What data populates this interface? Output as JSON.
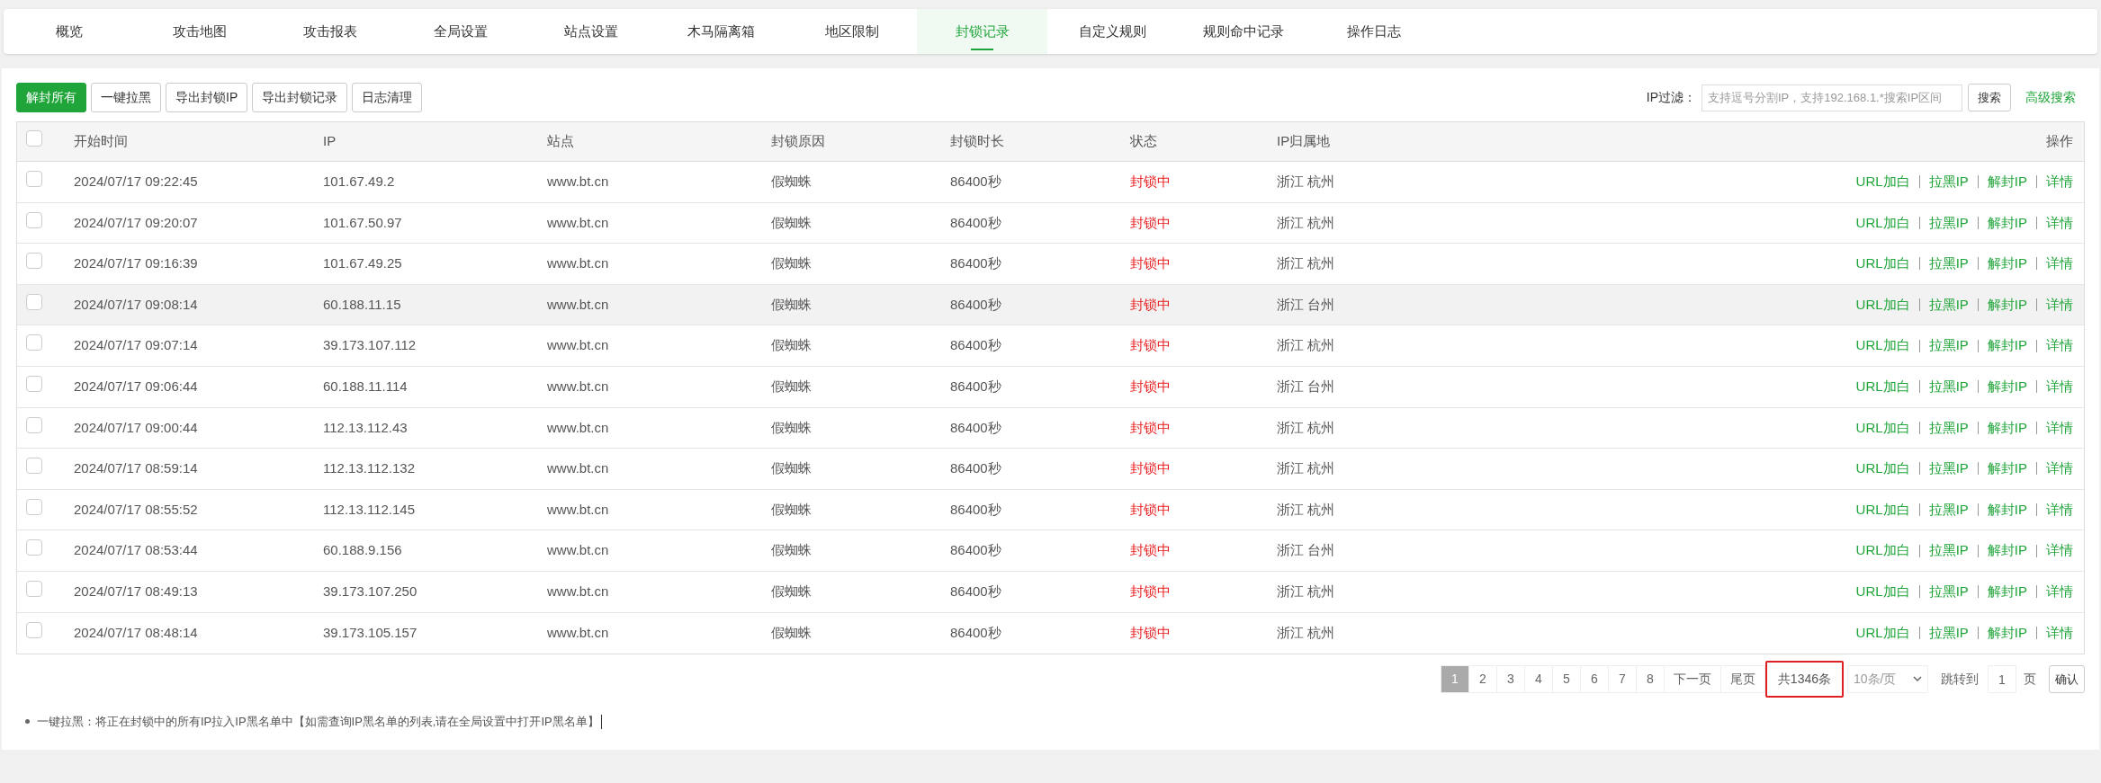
{
  "tabs": [
    {
      "label": "概览",
      "selected": false
    },
    {
      "label": "攻击地图",
      "selected": false
    },
    {
      "label": "攻击报表",
      "selected": false
    },
    {
      "label": "全局设置",
      "selected": false
    },
    {
      "label": "站点设置",
      "selected": false
    },
    {
      "label": "木马隔离箱",
      "selected": false
    },
    {
      "label": "地区限制",
      "selected": false
    },
    {
      "label": "封锁记录",
      "selected": true
    },
    {
      "label": "自定义规则",
      "selected": false
    },
    {
      "label": "规则命中记录",
      "selected": false
    },
    {
      "label": "操作日志",
      "selected": false
    }
  ],
  "toolbar": {
    "buttons": [
      {
        "label": "解封所有",
        "kind": "primary"
      },
      {
        "label": "一键拉黑",
        "kind": "default"
      },
      {
        "label": "导出封锁IP",
        "kind": "default"
      },
      {
        "label": "导出封锁记录",
        "kind": "default"
      },
      {
        "label": "日志清理",
        "kind": "default"
      }
    ],
    "filter": {
      "label": "IP过滤：",
      "placeholder": "支持逗号分割IP，支持192.168.1.*搜索IP区间",
      "button": "搜索",
      "link": "高级搜索"
    }
  },
  "table": {
    "select_all_checked": false,
    "columns": [
      "开始时间",
      "IP",
      "站点",
      "封锁原因",
      "封锁时长",
      "状态",
      "IP归属地",
      "操作"
    ],
    "rows": [
      {
        "checked": false,
        "highlighted": false,
        "start_time": "2024/07/17 09:22:45",
        "ip": "101.67.49.2",
        "site": "www.bt.cn",
        "reason": "假蜘蛛",
        "duration": "86400秒",
        "status": {
          "text": "封锁中",
          "color": "#e81b1b"
        },
        "location": "浙江 杭州",
        "actions": [
          "URL加白",
          "拉黑IP",
          "解封IP",
          "详情"
        ]
      },
      {
        "checked": false,
        "highlighted": false,
        "start_time": "2024/07/17 09:20:07",
        "ip": "101.67.50.97",
        "site": "www.bt.cn",
        "reason": "假蜘蛛",
        "duration": "86400秒",
        "status": {
          "text": "封锁中",
          "color": "#e81b1b"
        },
        "location": "浙江 杭州",
        "actions": [
          "URL加白",
          "拉黑IP",
          "解封IP",
          "详情"
        ]
      },
      {
        "checked": false,
        "highlighted": false,
        "start_time": "2024/07/17 09:16:39",
        "ip": "101.67.49.25",
        "site": "www.bt.cn",
        "reason": "假蜘蛛",
        "duration": "86400秒",
        "status": {
          "text": "封锁中",
          "color": "#e81b1b"
        },
        "location": "浙江 杭州",
        "actions": [
          "URL加白",
          "拉黑IP",
          "解封IP",
          "详情"
        ]
      },
      {
        "checked": false,
        "highlighted": true,
        "start_time": "2024/07/17 09:08:14",
        "ip": "60.188.11.15",
        "site": "www.bt.cn",
        "reason": "假蜘蛛",
        "duration": "86400秒",
        "status": {
          "text": "封锁中",
          "color": "#e81b1b"
        },
        "location": "浙江 台州",
        "actions": [
          "URL加白",
          "拉黑IP",
          "解封IP",
          "详情"
        ]
      },
      {
        "checked": false,
        "highlighted": false,
        "start_time": "2024/07/17 09:07:14",
        "ip": "39.173.107.112",
        "site": "www.bt.cn",
        "reason": "假蜘蛛",
        "duration": "86400秒",
        "status": {
          "text": "封锁中",
          "color": "#e81b1b"
        },
        "location": "浙江 杭州",
        "actions": [
          "URL加白",
          "拉黑IP",
          "解封IP",
          "详情"
        ]
      },
      {
        "checked": false,
        "highlighted": false,
        "start_time": "2024/07/17 09:06:44",
        "ip": "60.188.11.114",
        "site": "www.bt.cn",
        "reason": "假蜘蛛",
        "duration": "86400秒",
        "status": {
          "text": "封锁中",
          "color": "#e81b1b"
        },
        "location": "浙江 台州",
        "actions": [
          "URL加白",
          "拉黑IP",
          "解封IP",
          "详情"
        ]
      },
      {
        "checked": false,
        "highlighted": false,
        "start_time": "2024/07/17 09:00:44",
        "ip": "112.13.112.43",
        "site": "www.bt.cn",
        "reason": "假蜘蛛",
        "duration": "86400秒",
        "status": {
          "text": "封锁中",
          "color": "#e81b1b"
        },
        "location": "浙江 杭州",
        "actions": [
          "URL加白",
          "拉黑IP",
          "解封IP",
          "详情"
        ]
      },
      {
        "checked": false,
        "highlighted": false,
        "start_time": "2024/07/17 08:59:14",
        "ip": "112.13.112.132",
        "site": "www.bt.cn",
        "reason": "假蜘蛛",
        "duration": "86400秒",
        "status": {
          "text": "封锁中",
          "color": "#e81b1b"
        },
        "location": "浙江 杭州",
        "actions": [
          "URL加白",
          "拉黑IP",
          "解封IP",
          "详情"
        ]
      },
      {
        "checked": false,
        "highlighted": false,
        "start_time": "2024/07/17 08:55:52",
        "ip": "112.13.112.145",
        "site": "www.bt.cn",
        "reason": "假蜘蛛",
        "duration": "86400秒",
        "status": {
          "text": "封锁中",
          "color": "#e81b1b"
        },
        "location": "浙江 杭州",
        "actions": [
          "URL加白",
          "拉黑IP",
          "解封IP",
          "详情"
        ]
      },
      {
        "checked": false,
        "highlighted": false,
        "start_time": "2024/07/17 08:53:44",
        "ip": "60.188.9.156",
        "site": "www.bt.cn",
        "reason": "假蜘蛛",
        "duration": "86400秒",
        "status": {
          "text": "封锁中",
          "color": "#e81b1b"
        },
        "location": "浙江 台州",
        "actions": [
          "URL加白",
          "拉黑IP",
          "解封IP",
          "详情"
        ]
      },
      {
        "checked": false,
        "highlighted": false,
        "start_time": "2024/07/17 08:49:13",
        "ip": "39.173.107.250",
        "site": "www.bt.cn",
        "reason": "假蜘蛛",
        "duration": "86400秒",
        "status": {
          "text": "封锁中",
          "color": "#e81b1b"
        },
        "location": "浙江 杭州",
        "actions": [
          "URL加白",
          "拉黑IP",
          "解封IP",
          "详情"
        ]
      },
      {
        "checked": false,
        "highlighted": false,
        "start_time": "2024/07/17 08:48:14",
        "ip": "39.173.105.157",
        "site": "www.bt.cn",
        "reason": "假蜘蛛",
        "duration": "86400秒",
        "status": {
          "text": "封锁中",
          "color": "#e81b1b"
        },
        "location": "浙江 杭州",
        "actions": [
          "URL加白",
          "拉黑IP",
          "解封IP",
          "详情"
        ]
      }
    ]
  },
  "pagination": {
    "pages": [
      {
        "label": "1",
        "selected": true
      },
      {
        "label": "2",
        "selected": false
      },
      {
        "label": "3",
        "selected": false
      },
      {
        "label": "4",
        "selected": false
      },
      {
        "label": "5",
        "selected": false
      },
      {
        "label": "6",
        "selected": false
      },
      {
        "label": "7",
        "selected": false
      },
      {
        "label": "8",
        "selected": false
      }
    ],
    "next": "下一页",
    "last": "尾页",
    "total": "共1346条",
    "total_boxed": true,
    "per_page": "10条/页",
    "jump_label": "跳转到",
    "jump_value": "1",
    "page_unit": "页",
    "confirm": "确认"
  },
  "note": "一键拉黑：将正在封锁中的所有IP拉入IP黑名单中【如需查询IP黑名单的列表,请在全局设置中打开IP黑名单】"
}
